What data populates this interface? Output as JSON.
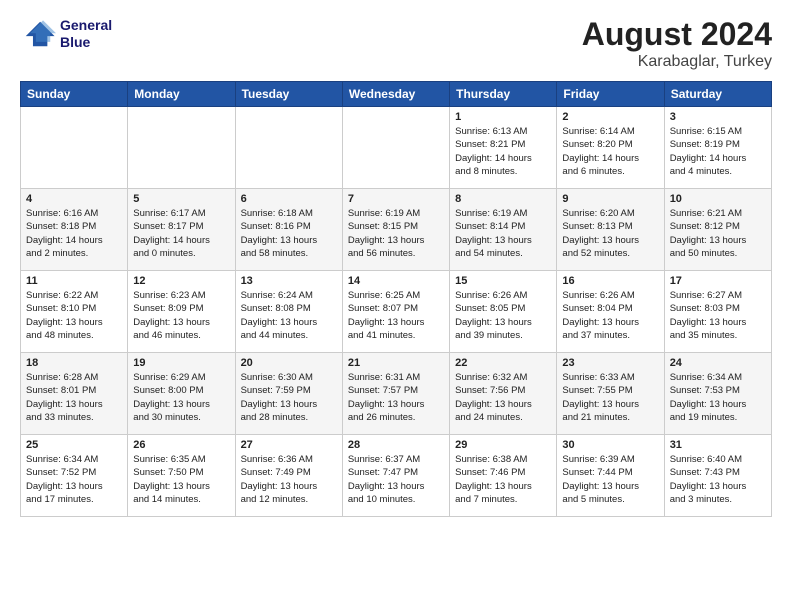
{
  "logo": {
    "line1": "General",
    "line2": "Blue"
  },
  "title": "August 2024",
  "subtitle": "Karabaglar, Turkey",
  "days_of_week": [
    "Sunday",
    "Monday",
    "Tuesday",
    "Wednesday",
    "Thursday",
    "Friday",
    "Saturday"
  ],
  "weeks": [
    [
      {
        "num": "",
        "info": ""
      },
      {
        "num": "",
        "info": ""
      },
      {
        "num": "",
        "info": ""
      },
      {
        "num": "",
        "info": ""
      },
      {
        "num": "1",
        "info": "Sunrise: 6:13 AM\nSunset: 8:21 PM\nDaylight: 14 hours\nand 8 minutes."
      },
      {
        "num": "2",
        "info": "Sunrise: 6:14 AM\nSunset: 8:20 PM\nDaylight: 14 hours\nand 6 minutes."
      },
      {
        "num": "3",
        "info": "Sunrise: 6:15 AM\nSunset: 8:19 PM\nDaylight: 14 hours\nand 4 minutes."
      }
    ],
    [
      {
        "num": "4",
        "info": "Sunrise: 6:16 AM\nSunset: 8:18 PM\nDaylight: 14 hours\nand 2 minutes."
      },
      {
        "num": "5",
        "info": "Sunrise: 6:17 AM\nSunset: 8:17 PM\nDaylight: 14 hours\nand 0 minutes."
      },
      {
        "num": "6",
        "info": "Sunrise: 6:18 AM\nSunset: 8:16 PM\nDaylight: 13 hours\nand 58 minutes."
      },
      {
        "num": "7",
        "info": "Sunrise: 6:19 AM\nSunset: 8:15 PM\nDaylight: 13 hours\nand 56 minutes."
      },
      {
        "num": "8",
        "info": "Sunrise: 6:19 AM\nSunset: 8:14 PM\nDaylight: 13 hours\nand 54 minutes."
      },
      {
        "num": "9",
        "info": "Sunrise: 6:20 AM\nSunset: 8:13 PM\nDaylight: 13 hours\nand 52 minutes."
      },
      {
        "num": "10",
        "info": "Sunrise: 6:21 AM\nSunset: 8:12 PM\nDaylight: 13 hours\nand 50 minutes."
      }
    ],
    [
      {
        "num": "11",
        "info": "Sunrise: 6:22 AM\nSunset: 8:10 PM\nDaylight: 13 hours\nand 48 minutes."
      },
      {
        "num": "12",
        "info": "Sunrise: 6:23 AM\nSunset: 8:09 PM\nDaylight: 13 hours\nand 46 minutes."
      },
      {
        "num": "13",
        "info": "Sunrise: 6:24 AM\nSunset: 8:08 PM\nDaylight: 13 hours\nand 44 minutes."
      },
      {
        "num": "14",
        "info": "Sunrise: 6:25 AM\nSunset: 8:07 PM\nDaylight: 13 hours\nand 41 minutes."
      },
      {
        "num": "15",
        "info": "Sunrise: 6:26 AM\nSunset: 8:05 PM\nDaylight: 13 hours\nand 39 minutes."
      },
      {
        "num": "16",
        "info": "Sunrise: 6:26 AM\nSunset: 8:04 PM\nDaylight: 13 hours\nand 37 minutes."
      },
      {
        "num": "17",
        "info": "Sunrise: 6:27 AM\nSunset: 8:03 PM\nDaylight: 13 hours\nand 35 minutes."
      }
    ],
    [
      {
        "num": "18",
        "info": "Sunrise: 6:28 AM\nSunset: 8:01 PM\nDaylight: 13 hours\nand 33 minutes."
      },
      {
        "num": "19",
        "info": "Sunrise: 6:29 AM\nSunset: 8:00 PM\nDaylight: 13 hours\nand 30 minutes."
      },
      {
        "num": "20",
        "info": "Sunrise: 6:30 AM\nSunset: 7:59 PM\nDaylight: 13 hours\nand 28 minutes."
      },
      {
        "num": "21",
        "info": "Sunrise: 6:31 AM\nSunset: 7:57 PM\nDaylight: 13 hours\nand 26 minutes."
      },
      {
        "num": "22",
        "info": "Sunrise: 6:32 AM\nSunset: 7:56 PM\nDaylight: 13 hours\nand 24 minutes."
      },
      {
        "num": "23",
        "info": "Sunrise: 6:33 AM\nSunset: 7:55 PM\nDaylight: 13 hours\nand 21 minutes."
      },
      {
        "num": "24",
        "info": "Sunrise: 6:34 AM\nSunset: 7:53 PM\nDaylight: 13 hours\nand 19 minutes."
      }
    ],
    [
      {
        "num": "25",
        "info": "Sunrise: 6:34 AM\nSunset: 7:52 PM\nDaylight: 13 hours\nand 17 minutes."
      },
      {
        "num": "26",
        "info": "Sunrise: 6:35 AM\nSunset: 7:50 PM\nDaylight: 13 hours\nand 14 minutes."
      },
      {
        "num": "27",
        "info": "Sunrise: 6:36 AM\nSunset: 7:49 PM\nDaylight: 13 hours\nand 12 minutes."
      },
      {
        "num": "28",
        "info": "Sunrise: 6:37 AM\nSunset: 7:47 PM\nDaylight: 13 hours\nand 10 minutes."
      },
      {
        "num": "29",
        "info": "Sunrise: 6:38 AM\nSunset: 7:46 PM\nDaylight: 13 hours\nand 7 minutes."
      },
      {
        "num": "30",
        "info": "Sunrise: 6:39 AM\nSunset: 7:44 PM\nDaylight: 13 hours\nand 5 minutes."
      },
      {
        "num": "31",
        "info": "Sunrise: 6:40 AM\nSunset: 7:43 PM\nDaylight: 13 hours\nand 3 minutes."
      }
    ]
  ]
}
